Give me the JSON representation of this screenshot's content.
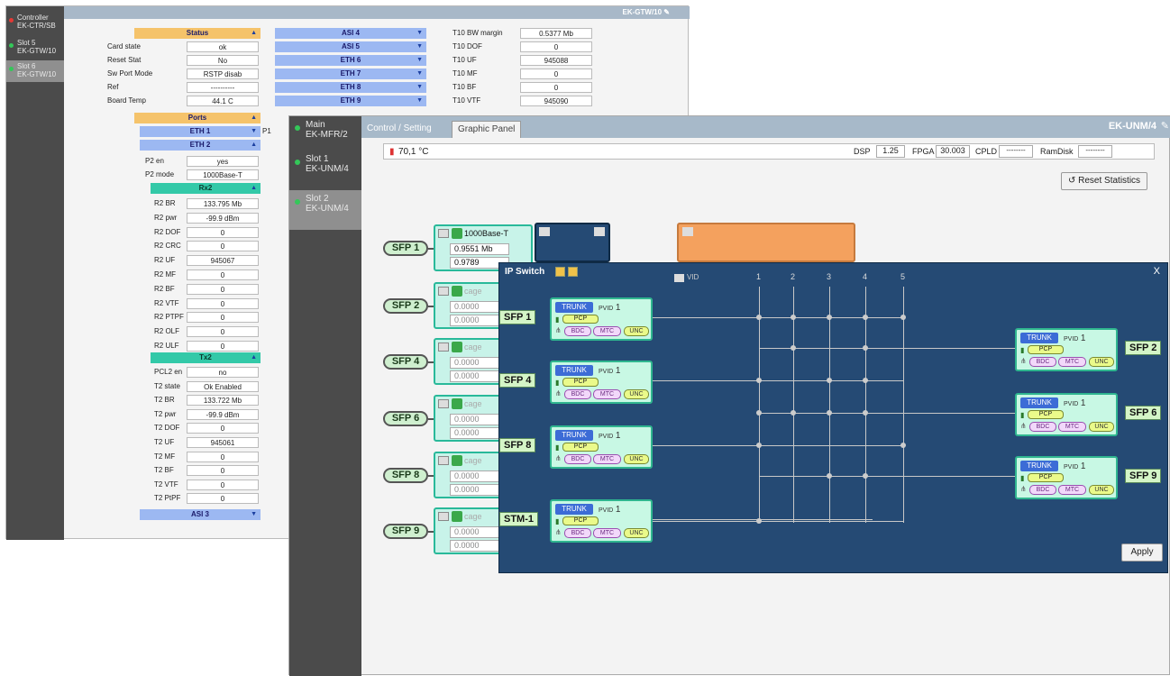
{
  "back_window": {
    "title": "EK-GTW/10",
    "sidebar": [
      {
        "name": "Controller",
        "model": "EK-CTR/SB",
        "status": "red"
      },
      {
        "name": "Slot 5",
        "model": "EK-GTW/10",
        "status": "green"
      },
      {
        "name": "Slot 6",
        "model": "EK-GTW/10",
        "status": "green"
      }
    ],
    "status_header": "Status",
    "status_rows": [
      {
        "label": "Card state",
        "value": "ok"
      },
      {
        "label": "Reset Stat",
        "value": "No"
      },
      {
        "label": "Sw Port Mode",
        "value": "RSTP disab"
      },
      {
        "label": "Ref",
        "value": "----------"
      },
      {
        "label": "Board Temp",
        "value": "44.1 C"
      }
    ],
    "asi_headers": [
      "ASI 4",
      "ASI 5",
      "ETH 6",
      "ETH 7",
      "ETH 8",
      "ETH 9"
    ],
    "t10_rows": [
      {
        "label": "T10 BW margin",
        "value": "0.5377 Mb"
      },
      {
        "label": "T10 DOF",
        "value": "0"
      },
      {
        "label": "T10 UF",
        "value": "945088"
      },
      {
        "label": "T10 MF",
        "value": "0"
      },
      {
        "label": "T10 BF",
        "value": "0"
      },
      {
        "label": "T10 VTF",
        "value": "945090"
      }
    ],
    "ports_header": "Ports",
    "eth1": "ETH 1",
    "eth2": "ETH 2",
    "p1_label": "P1",
    "p2_rows": [
      {
        "label": "P2 en",
        "value": "yes"
      },
      {
        "label": "P2 mode",
        "value": "1000Base-T"
      }
    ],
    "rx2_header": "Rx2",
    "rx2_rows": [
      {
        "label": "R2 BR",
        "value": "133.795 Mb"
      },
      {
        "label": "R2 pwr",
        "value": "-99.9 dBm"
      },
      {
        "label": "R2 DOF",
        "value": "0"
      },
      {
        "label": "R2 CRC",
        "value": "0"
      },
      {
        "label": "R2 UF",
        "value": "945067"
      },
      {
        "label": "R2 MF",
        "value": "0"
      },
      {
        "label": "R2 BF",
        "value": "0"
      },
      {
        "label": "R2 VTF",
        "value": "0"
      },
      {
        "label": "R2 PTPF",
        "value": "0"
      },
      {
        "label": "R2 OLF",
        "value": "0"
      },
      {
        "label": "R2 ULF",
        "value": "0"
      }
    ],
    "tx2_header": "Tx2",
    "tx2_rows": [
      {
        "label": "PCL2 en",
        "value": "no"
      },
      {
        "label": "T2 state",
        "value": "Ok Enabled"
      },
      {
        "label": "T2 BR",
        "value": "133.722 Mb"
      },
      {
        "label": "T2 pwr",
        "value": "-99.9 dBm"
      },
      {
        "label": "T2 DOF",
        "value": "0"
      },
      {
        "label": "T2 UF",
        "value": "945061"
      },
      {
        "label": "T2 MF",
        "value": "0"
      },
      {
        "label": "T2 BF",
        "value": "0"
      },
      {
        "label": "T2 VTF",
        "value": "0"
      },
      {
        "label": "T2 PtPF",
        "value": "0"
      }
    ],
    "asi3": "ASI 3"
  },
  "front_window": {
    "title": "EK-UNM/4",
    "sidebar": [
      {
        "name": "Main",
        "model": "EK-MFR/2"
      },
      {
        "name": "Slot 1",
        "model": "EK-UNM/4"
      },
      {
        "name": "Slot 2",
        "model": "EK-UNM/4"
      }
    ],
    "tabs": [
      "Control / Setting",
      "Graphic Panel"
    ],
    "temp": "70,1 °C",
    "dsp_label": "DSP",
    "dsp_value": "1.25",
    "fpga_label": "FPGA",
    "fpga_value": "30.003",
    "cpld_label": "CPLD",
    "cpld_value": "--------",
    "ramdisk_label": "RamDisk",
    "ramdisk_value": "--------",
    "reset_button": "Reset Statistics",
    "sfp_ports": [
      "SFP 1",
      "SFP 2",
      "SFP 4",
      "SFP 6",
      "SFP 8",
      "SFP 9"
    ],
    "card1": {
      "mode": "1000Base-T",
      "row1": "0.9551 Mb",
      "row2": "0.9789"
    },
    "cage_label": "cage",
    "cage_value": "0.0000"
  },
  "ip_switch": {
    "title": "IP Switch",
    "close": "X",
    "vid_label": "VID",
    "columns": [
      "1",
      "2",
      "3",
      "4",
      "5"
    ],
    "trunk": "TRUNK",
    "pvid_label": "PVID",
    "pvid_value": "1",
    "pcp": "PCP",
    "chips": [
      "BDC",
      "MTC",
      "UNC"
    ],
    "left_ports": [
      "SFP 1",
      "SFP 4",
      "SFP 8",
      "STM-1"
    ],
    "right_ports": [
      "SFP 2",
      "SFP 6",
      "SFP 9"
    ],
    "apply": "Apply"
  }
}
